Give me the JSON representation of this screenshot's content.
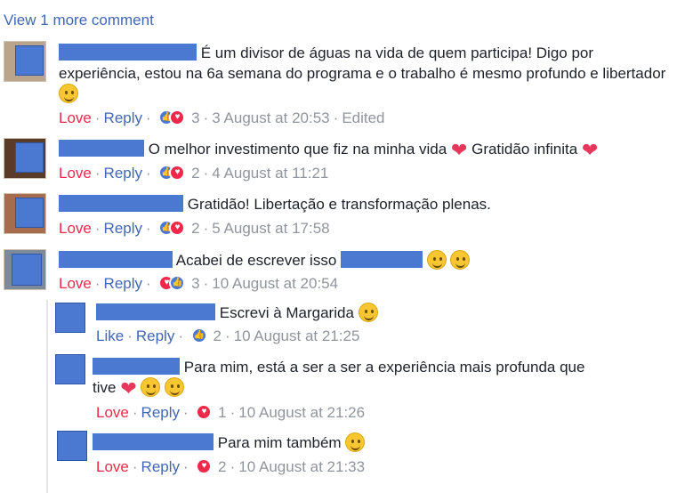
{
  "view_more": "View 1 more comment",
  "comments": [
    {
      "text": "É um divisor de águas na vida de quem participa! Digo por experiência, estou na 6a semana do programa e o trabalho é mesmo profundo e libertador",
      "action1": "Love",
      "reply": "Reply",
      "count": "3",
      "date": "3 August at 20:53",
      "edited": "Edited"
    },
    {
      "text": "O melhor investimento que fiz na minha vida",
      "text2": "Gratidão infinita",
      "action1": "Love",
      "reply": "Reply",
      "count": "2",
      "date": "4 August at 11:21"
    },
    {
      "text": "Gratidão! Libertação e transformação plenas.",
      "action1": "Love",
      "reply": "Reply",
      "count": "2",
      "date": "5 August at 17:58"
    },
    {
      "text": "Acabei de escrever isso",
      "action1": "Love",
      "reply": "Reply",
      "count": "3",
      "date": "10 August at 20:54"
    }
  ],
  "replies": [
    {
      "text": "Escrevi à Margarida",
      "action1": "Like",
      "reply": "Reply",
      "count": "2",
      "date": "10 August at 21:25"
    },
    {
      "text": "Para mim, está a ser a ser a experiência mais profunda que",
      "text_line2": "tive",
      "action1": "Love",
      "reply": "Reply",
      "count": "1",
      "date": "10 August at 21:26"
    },
    {
      "text": "Para mim também",
      "action1": "Love",
      "reply": "Reply",
      "count": "2",
      "date": "10 August at 21:33"
    }
  ],
  "separator": "·",
  "colors": {
    "link": "#4267b2",
    "love": "#f0284a",
    "meta": "#90949c",
    "redaction": "#4b79d2"
  },
  "icons": [
    "like-reaction-icon",
    "love-reaction-icon",
    "smile-emoji",
    "heart-emoji",
    "wink-emoji",
    "laugh-emoji",
    "heart-eyes-emoji",
    "kiss-emoji"
  ]
}
